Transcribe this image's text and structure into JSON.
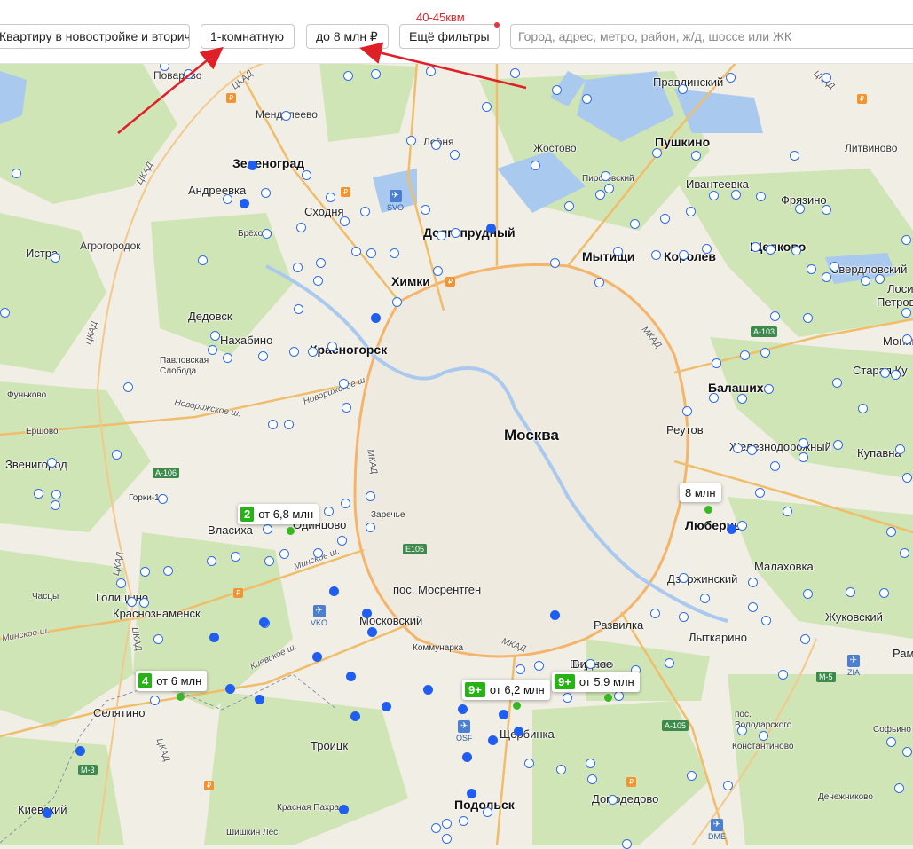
{
  "annotation": "40-45квм",
  "filters": {
    "type_label": "Квартиру в новостройке и вторичке",
    "rooms_label": "1-комнатную",
    "price_label": "до 8 млн ₽",
    "more_label": "Ещё фильтры",
    "search_placeholder": "Город, адрес, метро, район, ж/д, шоссе или ЖК"
  },
  "colors": {
    "marker": "#2f6ee6",
    "marker_filled": "#1f5ef0",
    "cluster_badge": "#27b316",
    "annotation": "#d9262b"
  },
  "map": {
    "capital": "Москва",
    "cities": [
      "Зеленоград",
      "Химки",
      "Мытищи",
      "Королев",
      "Балашиха",
      "Люберцы",
      "Подольск",
      "Красногорск",
      "Долгопрудный",
      "Щелково",
      "Щербинка"
    ],
    "towns": [
      "Поварово",
      "Менделеево",
      "Лобня",
      "Жостово",
      "Правдинский",
      "Пушкино",
      "Литвиново",
      "Андреевка",
      "Пирогов­ский",
      "Ивантеевка",
      "Фрязино",
      "Сходня",
      "Брёхово",
      "Агрогородок",
      "Истра",
      "Свердловский",
      "Лосино-",
      "Петров",
      "Дедовск",
      "Нахабино",
      "Павловская Слобода",
      "Фуньково",
      "Ершово",
      "Звенигород",
      "Горки-10",
      "Реутов",
      "Железнодорожный",
      "Купавна",
      "Монин",
      "Старая Ку",
      "Власиха",
      "Одинцово",
      "Заречье",
      "Малаховка",
      "Дзержинский",
      "Голицыно",
      "Часцы",
      "Краснознаменск",
      "пос. Мосрентген",
      "Московский",
      "Коммунарка",
      "Внуково",
      "Развилка",
      "Лыткарино",
      "Жуковский",
      "Раменское",
      "Селятино",
      "Троицк",
      "Видное",
      "пос. Володарского",
      "Константиново",
      "Софьино",
      "Домодедово",
      "Денежниково",
      "Киевский",
      "Красная Пахра",
      "Шишкин Лес"
    ],
    "roads": [
      "ЦКАД",
      "МКАД",
      "Новорижское ш.",
      "Минское ш.",
      "Киевское ш."
    ],
    "shields": [
      "А-106",
      "А-103",
      "E105",
      "М-3",
      "М-5",
      "А-105"
    ],
    "airports": [
      "SVO",
      "VKO",
      "ZIA",
      "DME",
      "OSF"
    ]
  },
  "clusters": [
    {
      "count": "2",
      "price": "от 6,8 млн"
    },
    {
      "count": "",
      "price": "8 млн"
    },
    {
      "count": "4",
      "price": "от 6 млн"
    },
    {
      "count": "9+",
      "price": "от 6,2 млн"
    },
    {
      "count": "9+",
      "price": "от 5,9 млн"
    }
  ]
}
